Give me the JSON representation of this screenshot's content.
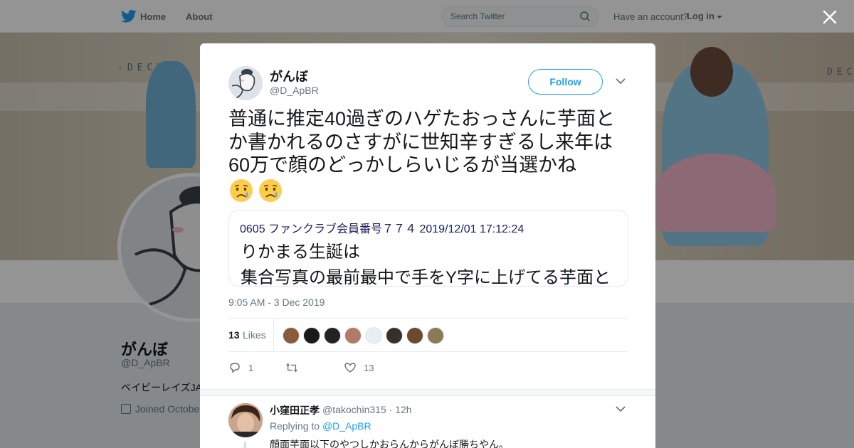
{
  "nav": {
    "home_label": "Home",
    "about_label": "About",
    "search_placeholder": "Search Twitter",
    "have_account": "Have an account?",
    "login_label": "Log in"
  },
  "banner": {
    "sign_left": "-DECKS-",
    "sign_right": "DEC"
  },
  "profile": {
    "name": "がんぼ",
    "handle": "@D_ApBR",
    "bio": "ベイビーレイズJA",
    "joined": "Joined Octobe"
  },
  "tweet": {
    "author_name": "がんぼ",
    "author_handle": "@D_ApBR",
    "follow_label": "Follow",
    "text": "普通に推定40過ぎのハゲたおっさんに芋面とか書かれるのさすがに世知辛すぎるし来年は60万で顔のどっかしらいじるが当選かね",
    "emojis": [
      "crying-face",
      "crying-face"
    ],
    "quote": {
      "header": "0605 ファンクラブ会員番号７７４ 2019/12/01 17:12:24",
      "line1": "りかまる生誕は",
      "line2": "集合写真の最前最中で手をY字に上げてる芋面と"
    },
    "timestamp": "9:05 AM - 3 Dec 2019",
    "likes_count": "13",
    "likes_label": "Likes",
    "liker_colors": [
      "#8a5a3c",
      "#1a1a1a",
      "#222222",
      "#b27a68",
      "#e8eef2",
      "#3a2e2a",
      "#6b4a2e",
      "#8a7a55"
    ],
    "actions": {
      "reply_count": "1",
      "retweet_count": "",
      "like_count": "13"
    }
  },
  "reply": {
    "name": "小窪田正孝",
    "handle": "@takochin315 · 12h",
    "replying_prefix": "Replying to",
    "replying_mention": "@D_ApBR",
    "text": "顔面芋面以下のやつしかおらんからがんぼ勝ちやん。"
  },
  "colors": {
    "accent": "#1da1f2",
    "text_primary": "#14171a",
    "text_secondary": "#657786"
  }
}
